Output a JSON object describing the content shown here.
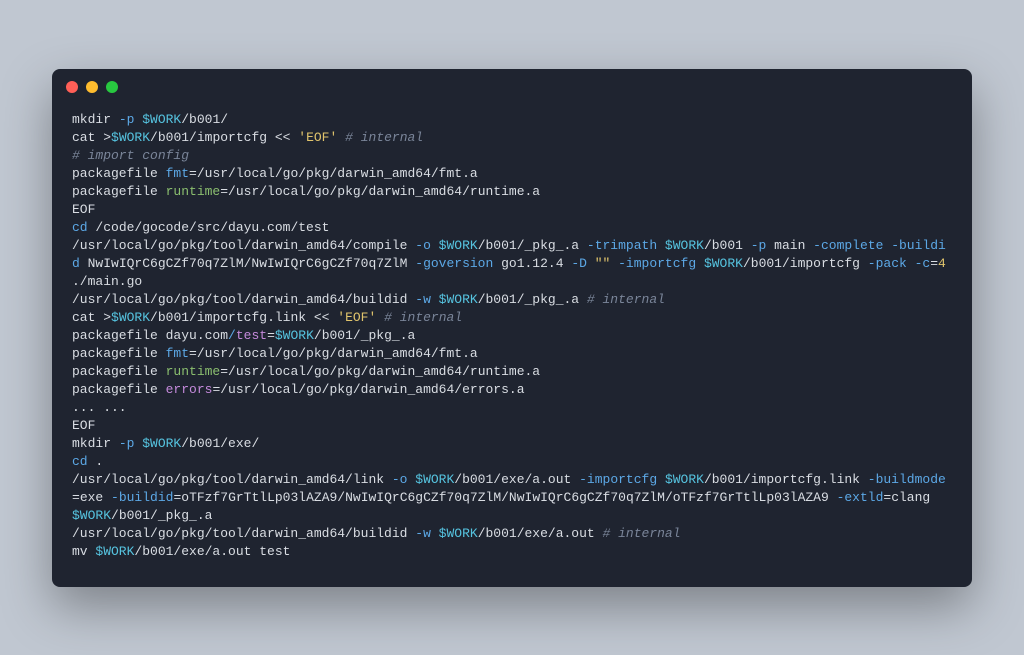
{
  "window": {
    "btn_colors": {
      "close": "#ff5f57",
      "min": "#febc2e",
      "max": "#28c840"
    }
  },
  "tokens": [
    [
      [
        "mkdir ",
        "cmd"
      ],
      [
        "-p ",
        "blue"
      ],
      [
        "$WORK",
        "cyan"
      ],
      [
        "/b001/",
        "cmd"
      ]
    ],
    [
      [
        "cat ",
        "cmd"
      ],
      [
        ">",
        "cmd"
      ],
      [
        "$WORK",
        "cyan"
      ],
      [
        "/b001/importcfg ",
        "cmd"
      ],
      [
        "<< ",
        "cmd"
      ],
      [
        "'EOF'",
        "yel"
      ],
      [
        " ",
        "cmd"
      ],
      [
        "# internal",
        "com"
      ]
    ],
    [
      [
        "# import config",
        "com"
      ]
    ],
    [
      [
        "packagefile ",
        "cmd"
      ],
      [
        "fmt",
        "blue"
      ],
      [
        "=",
        "cmd"
      ],
      [
        "/usr/local/go/pkg/darwin_amd64/fmt.a",
        "cmd"
      ]
    ],
    [
      [
        "packagefile ",
        "cmd"
      ],
      [
        "runtime",
        "grn"
      ],
      [
        "=",
        "cmd"
      ],
      [
        "/usr/local/go/pkg/darwin_amd64/runtime.a",
        "cmd"
      ]
    ],
    [
      [
        "EOF",
        "cmd"
      ]
    ],
    [
      [
        "cd",
        "blue"
      ],
      [
        " /code/gocode/src/dayu.com/test",
        "cmd"
      ]
    ],
    [
      [
        "/usr/local/go/pkg/tool/darwin_amd64/compile ",
        "cmd"
      ],
      [
        "-o ",
        "blue"
      ],
      [
        "$WORK",
        "cyan"
      ],
      [
        "/b001/_pkg_.a ",
        "cmd"
      ],
      [
        "-trimpath ",
        "blue"
      ],
      [
        "$WORK",
        "cyan"
      ],
      [
        "/b001 ",
        "cmd"
      ],
      [
        "-p",
        "blue"
      ],
      [
        " main ",
        "cmd"
      ],
      [
        "-complete ",
        "blue"
      ],
      [
        "-buildid ",
        "blue"
      ],
      [
        "NwIwIQrC6gCZf70q7ZlM/NwIwIQrC6gCZf70q7ZlM ",
        "cmd"
      ],
      [
        "-goversion ",
        "blue"
      ],
      [
        "go1.12.4 ",
        "cmd"
      ],
      [
        "-D ",
        "blue"
      ],
      [
        "\"\" ",
        "yel"
      ],
      [
        "-importcfg ",
        "blue"
      ],
      [
        "$WORK",
        "cyan"
      ],
      [
        "/b001/importcfg ",
        "cmd"
      ],
      [
        "-pack ",
        "blue"
      ],
      [
        "-c",
        "blue"
      ],
      [
        "=",
        "cmd"
      ],
      [
        "4",
        "yel"
      ],
      [
        " ./main.go",
        "cmd"
      ]
    ],
    [
      [
        "/usr/local/go/pkg/tool/darwin_amd64/buildid ",
        "cmd"
      ],
      [
        "-w ",
        "blue"
      ],
      [
        "$WORK",
        "cyan"
      ],
      [
        "/b001/_pkg_.a ",
        "cmd"
      ],
      [
        "# internal",
        "com"
      ]
    ],
    [
      [
        "cat ",
        "cmd"
      ],
      [
        ">",
        "cmd"
      ],
      [
        "$WORK",
        "cyan"
      ],
      [
        "/b001/importcfg.link ",
        "cmd"
      ],
      [
        "<< ",
        "cmd"
      ],
      [
        "'EOF'",
        "yel"
      ],
      [
        " ",
        "cmd"
      ],
      [
        "# internal",
        "com"
      ]
    ],
    [
      [
        "packagefile dayu.com",
        "cmd"
      ],
      [
        "/",
        "blue"
      ],
      [
        "test",
        "mag"
      ],
      [
        "=",
        "cmd"
      ],
      [
        "$WORK",
        "cyan"
      ],
      [
        "/b001/_pkg_.a",
        "cmd"
      ]
    ],
    [
      [
        "packagefile ",
        "cmd"
      ],
      [
        "fmt",
        "blue"
      ],
      [
        "=",
        "cmd"
      ],
      [
        "/usr/local/go/pkg/darwin_amd64/fmt.a",
        "cmd"
      ]
    ],
    [
      [
        "packagefile ",
        "cmd"
      ],
      [
        "runtime",
        "grn"
      ],
      [
        "=",
        "cmd"
      ],
      [
        "/usr/local/go/pkg/darwin_amd64/runtime.a",
        "cmd"
      ]
    ],
    [
      [
        "packagefile ",
        "cmd"
      ],
      [
        "errors",
        "mag"
      ],
      [
        "=",
        "cmd"
      ],
      [
        "/usr/local/go/pkg/darwin_amd64/errors.a",
        "cmd"
      ]
    ],
    [
      [
        "... ...",
        "cmd"
      ]
    ],
    [
      [
        "EOF",
        "cmd"
      ]
    ],
    [
      [
        "mkdir ",
        "cmd"
      ],
      [
        "-p ",
        "blue"
      ],
      [
        "$WORK",
        "cyan"
      ],
      [
        "/b001/exe/",
        "cmd"
      ]
    ],
    [
      [
        "cd",
        "blue"
      ],
      [
        " .",
        "cmd"
      ]
    ],
    [
      [
        "/usr/local/go/pkg/tool/darwin_amd64/link ",
        "cmd"
      ],
      [
        "-o ",
        "blue"
      ],
      [
        "$WORK",
        "cyan"
      ],
      [
        "/b001/exe/a.out ",
        "cmd"
      ],
      [
        "-importcfg ",
        "blue"
      ],
      [
        "$WORK",
        "cyan"
      ],
      [
        "/b001/importcfg.link ",
        "cmd"
      ],
      [
        "-buildmode",
        "blue"
      ],
      [
        "=",
        "cmd"
      ],
      [
        "exe ",
        "cmd"
      ],
      [
        "-buildid",
        "blue"
      ],
      [
        "=",
        "cmd"
      ],
      [
        "oTFzf7GrTtlLp03lAZA9/NwIwIQrC6gCZf70q7ZlM/NwIwIQrC6gCZf70q7ZlM/oTFzf7GrTtlLp03lAZA9 ",
        "cmd"
      ],
      [
        "-extld",
        "blue"
      ],
      [
        "=",
        "cmd"
      ],
      [
        "clang ",
        "cmd"
      ],
      [
        "$WORK",
        "cyan"
      ],
      [
        "/b001/_pkg_.a",
        "cmd"
      ]
    ],
    [
      [
        "/usr/local/go/pkg/tool/darwin_amd64/buildid ",
        "cmd"
      ],
      [
        "-w ",
        "blue"
      ],
      [
        "$WORK",
        "cyan"
      ],
      [
        "/b001/exe/a.out ",
        "cmd"
      ],
      [
        "# internal",
        "com"
      ]
    ],
    [
      [
        "mv ",
        "cmd"
      ],
      [
        "$WORK",
        "cyan"
      ],
      [
        "/b001/exe/a.out ",
        "cmd"
      ],
      [
        "test",
        "cmd"
      ]
    ]
  ]
}
